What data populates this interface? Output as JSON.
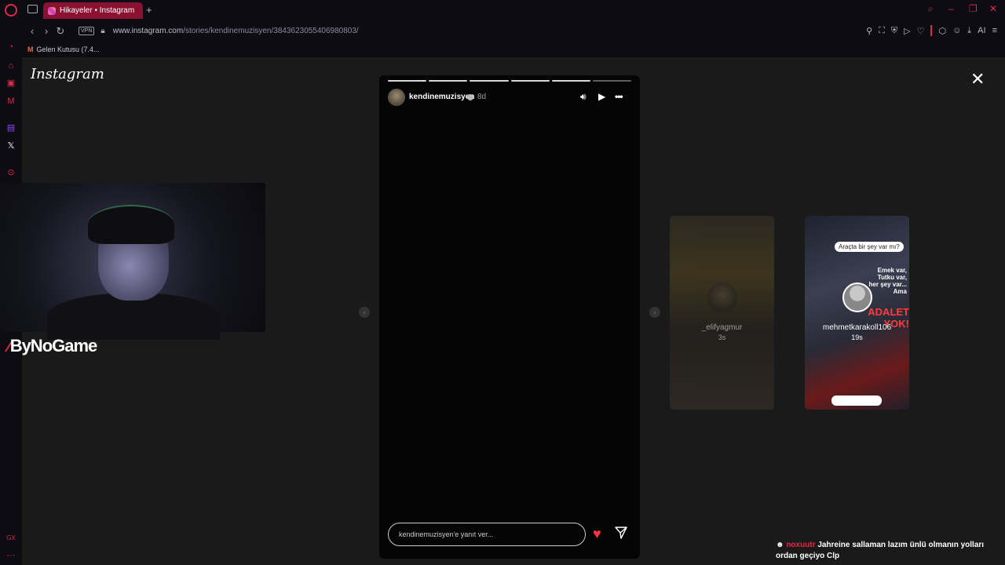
{
  "browser": {
    "tab_title": "Hikayeler • Instagram",
    "url_domain": "www.instagram.com",
    "url_path": "/stories/kendinemuzisyen/3843623055406980803/",
    "vpn_label": "VPN",
    "bookmark_gmail": "Gelen Kutusu (7.4...",
    "ai_label": "AI"
  },
  "instagram": {
    "logo": "Instagram",
    "story": {
      "username": "kendinemuzisyen",
      "time": "8d",
      "reply_placeholder": "kendinemuzisyen'e yanıt ver...",
      "progress_segments": 6,
      "progress_filled": 5
    },
    "previews": [
      {
        "name": "_elifyagmur",
        "time": "3s"
      },
      {
        "name": "mehmetkarakoll106",
        "time": "19s",
        "overlay_top": "Araçta bir şey var mı?",
        "overlay_mid": "Emek var, Tutku var, her şey var... Ama",
        "overlay_big": "ADALET YOK!"
      }
    ]
  },
  "stream": {
    "sponsor": "ByNoGame",
    "chat_user": "noxuutr",
    "chat_message": "Jahreine sallaman lazım ünlü olmanın yolları ordan geçiyo Clp"
  },
  "colors": {
    "accent": "#e0294a",
    "heart": "#ff3040"
  }
}
